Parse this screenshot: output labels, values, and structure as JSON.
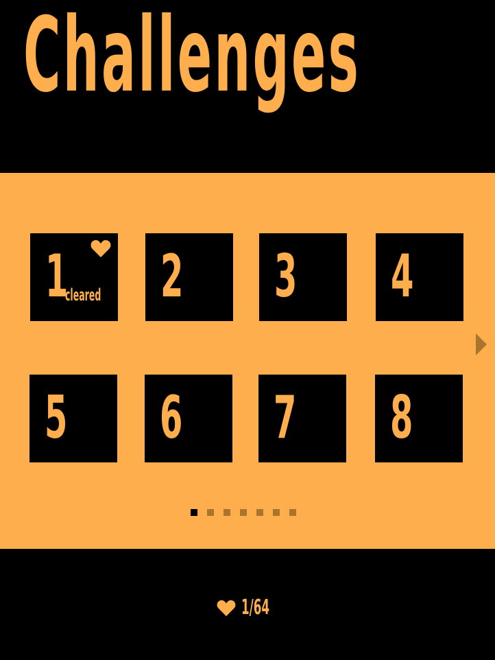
{
  "header": {
    "title": "Challenges"
  },
  "colors": {
    "accent": "#ffae4d",
    "background": "#000000",
    "inactive_dot": "#a9742b",
    "arrow": "#a9742b"
  },
  "challenges": [
    {
      "number": "1",
      "status": "cleared",
      "favorited": true
    },
    {
      "number": "2",
      "status": "",
      "favorited": false
    },
    {
      "number": "3",
      "status": "",
      "favorited": false
    },
    {
      "number": "4",
      "status": "",
      "favorited": false
    },
    {
      "number": "5",
      "status": "",
      "favorited": false
    },
    {
      "number": "6",
      "status": "",
      "favorited": false
    },
    {
      "number": "7",
      "status": "",
      "favorited": false
    },
    {
      "number": "8",
      "status": "",
      "favorited": false
    }
  ],
  "pager": {
    "total_pages": 7,
    "current_page": 1
  },
  "navigation": {
    "next_icon": "arrow-right-icon"
  },
  "footer": {
    "icon": "heart-icon",
    "count": "1/64"
  }
}
